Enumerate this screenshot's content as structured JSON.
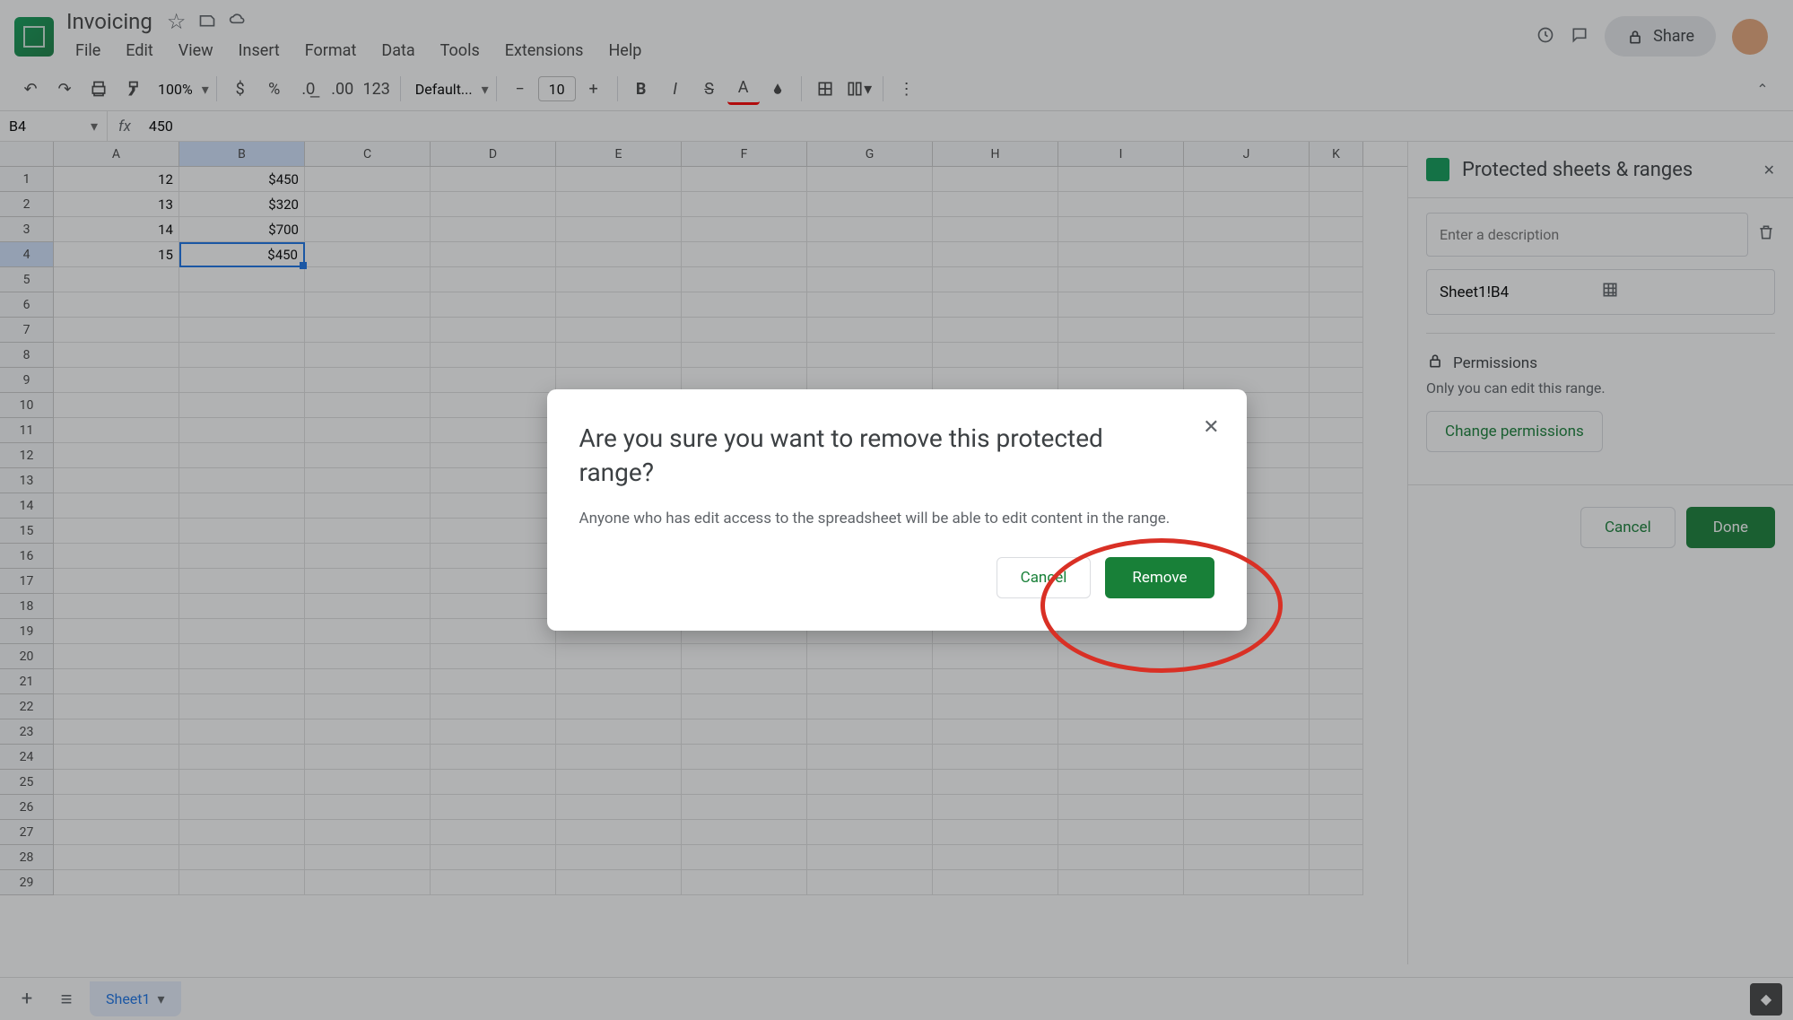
{
  "doc_title": "Invoicing",
  "menus": [
    "File",
    "Edit",
    "View",
    "Insert",
    "Format",
    "Data",
    "Tools",
    "Extensions",
    "Help"
  ],
  "share_label": "Share",
  "zoom": "100%",
  "font_name": "Default...",
  "font_size": "10",
  "name_box": "B4",
  "formula": "450",
  "columns": [
    "A",
    "B",
    "C",
    "D",
    "E",
    "F",
    "G",
    "H",
    "I",
    "J",
    "K"
  ],
  "col_widths": {
    "A": 140,
    "B": 140,
    "other": 140
  },
  "rows": [
    {
      "n": "1",
      "A": "12",
      "B": "$450"
    },
    {
      "n": "2",
      "A": "13",
      "B": "$320"
    },
    {
      "n": "3",
      "A": "14",
      "B": "$700"
    },
    {
      "n": "4",
      "A": "15",
      "B": "$450"
    }
  ],
  "empty_rows": [
    "5",
    "6",
    "7",
    "8",
    "9",
    "10",
    "11",
    "12",
    "13",
    "14",
    "15",
    "16",
    "17",
    "18",
    "19",
    "20",
    "21",
    "22",
    "23",
    "24",
    "25",
    "26",
    "27",
    "28",
    "29"
  ],
  "selected_cell": "B4",
  "sheet_tab": "Sheet1",
  "panel": {
    "title": "Protected sheets & ranges",
    "desc_placeholder": "Enter a description",
    "range": "Sheet1!B4",
    "perm_title": "Permissions",
    "perm_text": "Only you can edit this range.",
    "change_btn": "Change permissions",
    "cancel": "Cancel",
    "done": "Done"
  },
  "dialog": {
    "title": "Are you sure you want to remove this protected range?",
    "text": "Anyone who has edit access to the spreadsheet will be able to edit content in the range.",
    "cancel": "Cancel",
    "remove": "Remove"
  }
}
